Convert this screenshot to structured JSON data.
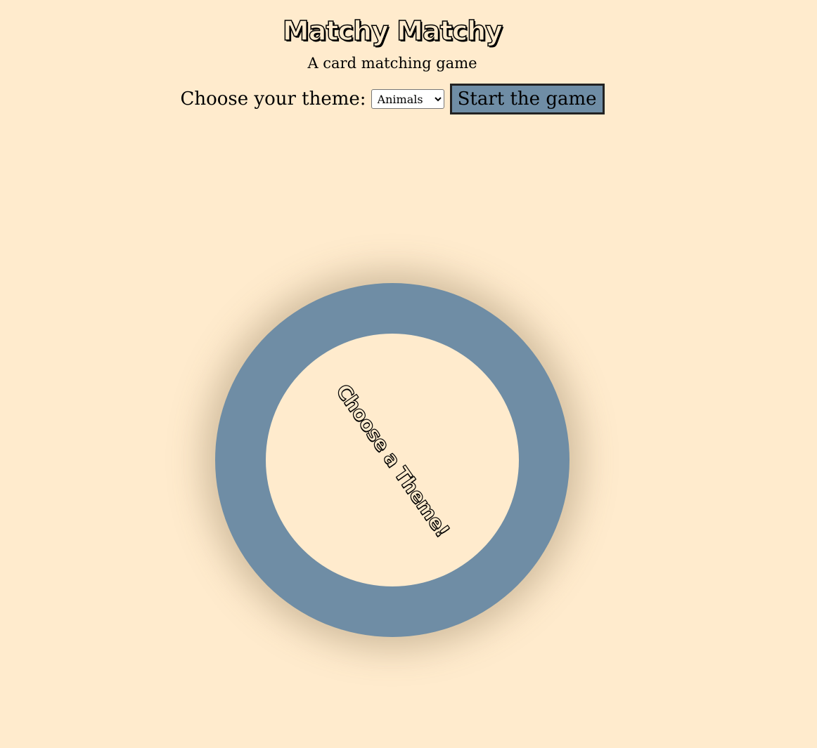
{
  "header": {
    "title": "Matchy Matchy",
    "subtitle": "A card matching game"
  },
  "controls": {
    "theme_label": "Choose your theme:",
    "theme_select": {
      "selected": "Animals",
      "options": [
        "Animals"
      ]
    },
    "start_button_label": "Start the game"
  },
  "board": {
    "prompt": "Choose a Theme!"
  },
  "colors": {
    "background": "#ffebcd",
    "accent": "#6f8da5"
  }
}
